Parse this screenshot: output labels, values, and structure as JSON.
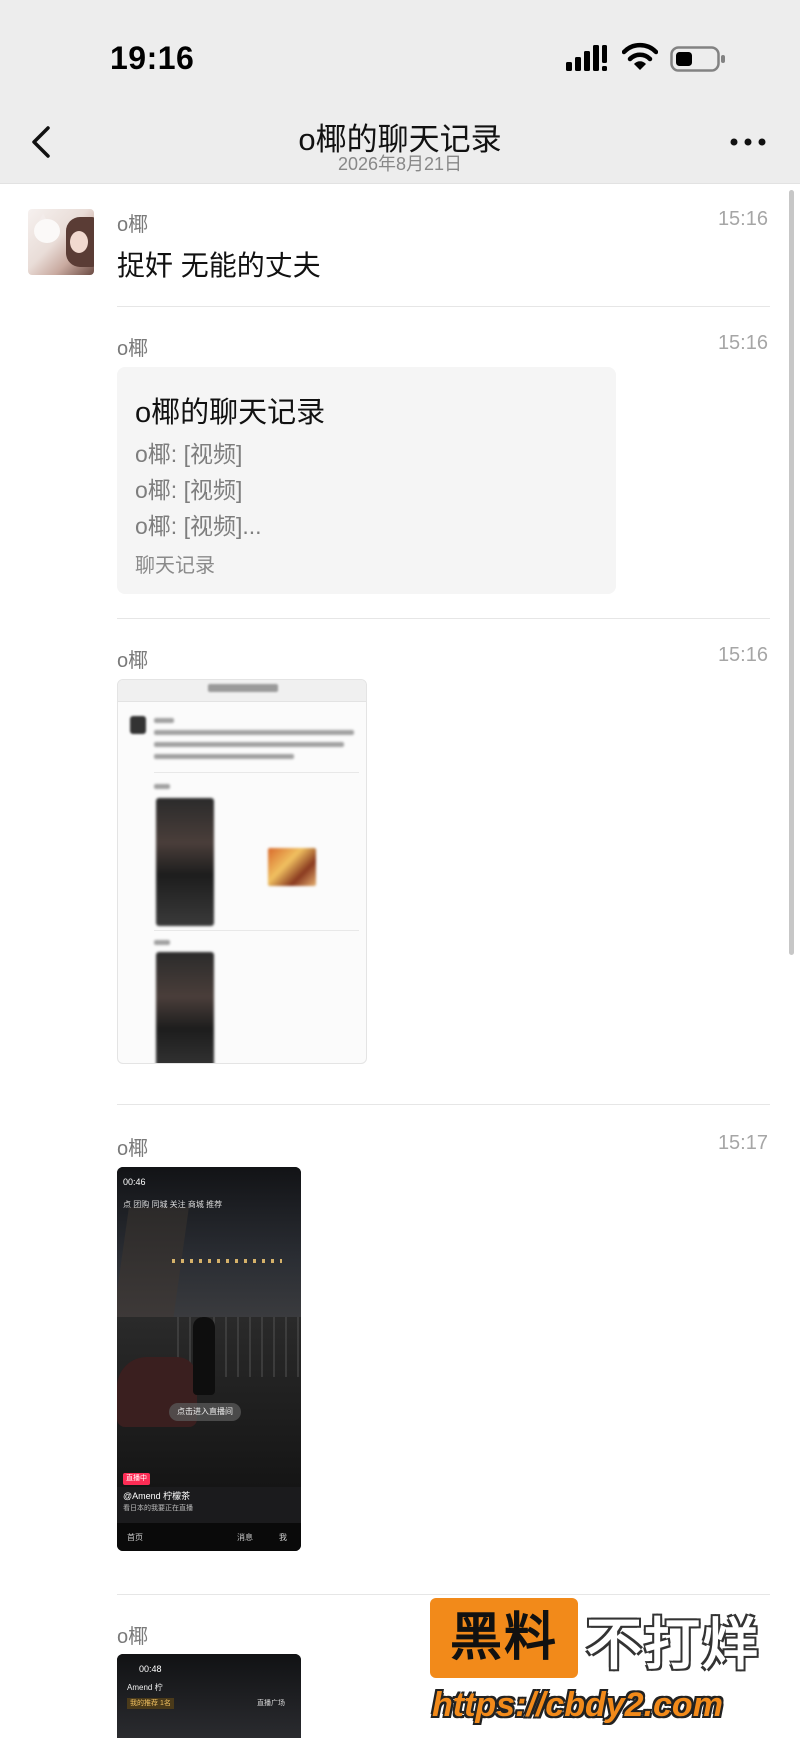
{
  "status_bar": {
    "time": "19:16"
  },
  "nav": {
    "title": "o椰的聊天记录",
    "subtitle": "2026年8月21日"
  },
  "messages": [
    {
      "sender": "o椰",
      "time": "15:16",
      "text": "捉奸 无能的丈夫"
    },
    {
      "sender": "o椰",
      "time": "15:16",
      "card": {
        "title": "o椰的聊天记录",
        "lines": [
          "o椰: [视频]",
          "o椰: [视频]",
          "o椰: [视频]..."
        ],
        "footer": "聊天记录"
      }
    },
    {
      "sender": "o椰",
      "time": "15:16"
    },
    {
      "sender": "o椰",
      "time": "15:17",
      "image": {
        "clock": "00:46",
        "tabs": "点 团购 同城 关注 商城 推荐",
        "live_button": "点击进入直播间",
        "tag": "直播中",
        "username": "@Amend 柠檬茶",
        "caption": "看日本的我要正在直播",
        "nav": [
          "首页",
          "消息",
          "我"
        ]
      }
    },
    {
      "sender": "o椰",
      "image": {
        "clock": "00:48",
        "username": "Amend 柠",
        "badge": "我的推荐 1名",
        "side": "直播广场"
      }
    }
  ],
  "watermark": {
    "box_text": "黑料",
    "side_text": "不打烊",
    "url": "https://cbdy2.com"
  }
}
